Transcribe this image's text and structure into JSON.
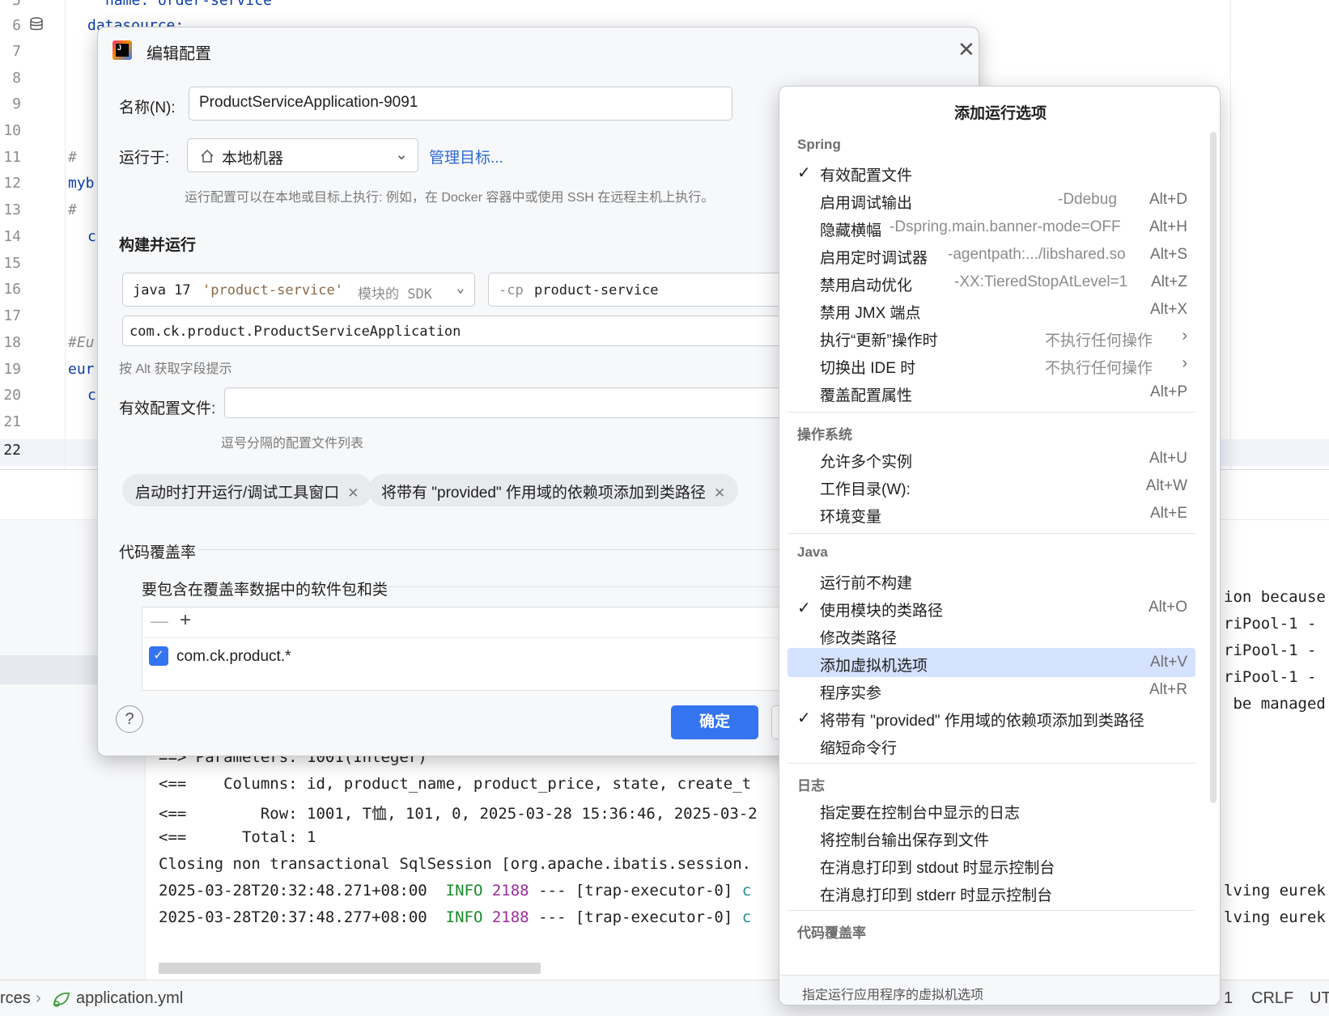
{
  "editor": {
    "line_numbers": [
      "5",
      "6",
      "7",
      "8",
      "9",
      "10",
      "11",
      "12",
      "13",
      "14",
      "15",
      "16",
      "17",
      "18",
      "19",
      "20",
      "21",
      "22"
    ],
    "code": {
      "l5": "name: order-service",
      "l6": "datasource:",
      "l11": "# ",
      "l12": "myb",
      "l13": "# ",
      "l14": "c",
      "l18": "#Eu",
      "l19": "eur",
      "l20": "c"
    }
  },
  "console": {
    "lines": [
      "==> Parameters: 1001(Integer)",
      "<==    Columns: id, product_name, product_price, state, create_t",
      "<==        Row: 1001, T恤, 101, 0, 2025-03-28 15:36:46, 2025-03-2",
      "<==      Total: 1",
      "Closing non transactional SqlSession [org.apache.ibatis.session."
    ],
    "log1": {
      "time": "2025-03-28T20:32:48.271+08:00",
      "level": "INFO",
      "pid": "2188",
      "sep": "---",
      "thread": "[trap-executor-0]",
      "cls": "c"
    },
    "log2": {
      "time": "2025-03-28T20:37:48.277+08:00",
      "level": "INFO",
      "pid": "2188",
      "sep": "---",
      "thread": "[trap-executor-0]",
      "cls": "c"
    },
    "right_lines": [
      "ion because",
      "riPool-1 -",
      "riPool-1 -",
      "riPool-1 -",
      " be managed",
      "",
      "",
      "",
      "",
      "",
      "",
      "lving eurek",
      "lving eurek"
    ]
  },
  "statusbar": {
    "crumb_left": "rces",
    "file": "application.yml",
    "right1": "1",
    "right2": "CRLF",
    "right3": "UT"
  },
  "dialog": {
    "title": "编辑配置",
    "name_label": "名称(N):",
    "name_value": "ProductServiceApplication-9091",
    "run_on_label": "运行于:",
    "run_on_value": "本地机器",
    "manage_targets": "管理目标...",
    "run_on_hint": "运行配置可以在本地或目标上执行: 例如，在 Docker 容器中或使用 SSH 在远程主机上执行。",
    "build_run_title": "构建并运行",
    "sdk_prefix": "java 17",
    "sdk_module": "'product-service'",
    "sdk_suffix": "模块的 SDK",
    "cp_flag": "-cp",
    "cp_value": "product-service",
    "main_class": "com.ck.product.ProductServiceApplication",
    "alt_hint": "按 Alt 获取字段提示",
    "profiles_label": "有效配置文件:",
    "profiles_value": "",
    "profiles_hint": "逗号分隔的配置文件列表",
    "chips": [
      "启动时打开运行/调试工具窗口",
      "将带有 \"provided\" 作用域的依赖项添加到类路径"
    ],
    "coverage_title": "代码覆盖率",
    "coverage_sub": "要包含在覆盖率数据中的软件包和类",
    "coverage_item": "com.ck.product.*",
    "ok": "确定",
    "help": "?"
  },
  "popup": {
    "title": "添加运行选项",
    "groups": {
      "spring": "Spring",
      "os": "操作系统",
      "java": "Java",
      "logs": "日志",
      "coverage": "代码覆盖率"
    },
    "spring_items": [
      {
        "label": "有效配置文件",
        "desc": "",
        "shortcut": "",
        "checked": "✓"
      },
      {
        "label": "启用调试输出",
        "desc": "-Ddebug",
        "shortcut": "Alt+D",
        "checked": ""
      },
      {
        "label": "隐藏横幅",
        "desc": "-Dspring.main.banner-mode=OFF",
        "shortcut": "Alt+H",
        "checked": ""
      },
      {
        "label": "启用定时调试器",
        "desc": "-agentpath:.../libshared.so",
        "shortcut": "Alt+S",
        "checked": ""
      },
      {
        "label": "禁用启动优化",
        "desc": "-XX:TieredStopAtLevel=1",
        "shortcut": "Alt+Z",
        "checked": ""
      },
      {
        "label": "禁用 JMX 端点",
        "desc": "",
        "shortcut": "Alt+X",
        "checked": ""
      },
      {
        "label": "执行“更新”操作时",
        "desc": "不执行任何操作",
        "shortcut": "",
        "checked": ""
      },
      {
        "label": "切换出 IDE 时",
        "desc": "不执行任何操作",
        "shortcut": "",
        "checked": ""
      },
      {
        "label": "覆盖配置属性",
        "desc": "",
        "shortcut": "Alt+P",
        "checked": ""
      }
    ],
    "os_items": [
      {
        "label": "允许多个实例",
        "shortcut": "Alt+U"
      },
      {
        "label": "工作目录(W):",
        "shortcut": "Alt+W"
      },
      {
        "label": "环境变量",
        "shortcut": "Alt+E"
      }
    ],
    "java_items": [
      {
        "label": "运行前不构建",
        "shortcut": "",
        "checked": ""
      },
      {
        "label": "使用模块的类路径",
        "shortcut": "Alt+O",
        "checked": "✓"
      },
      {
        "label": "修改类路径",
        "shortcut": "",
        "checked": ""
      },
      {
        "label": "添加虚拟机选项",
        "shortcut": "Alt+V",
        "checked": ""
      },
      {
        "label": "程序实参",
        "shortcut": "Alt+R",
        "checked": ""
      },
      {
        "label": "将带有 \"provided\" 作用域的依赖项添加到类路径",
        "shortcut": "",
        "checked": "✓"
      },
      {
        "label": "缩短命令行",
        "shortcut": "",
        "checked": ""
      }
    ],
    "log_items": [
      {
        "label": "指定要在控制台中显示的日志"
      },
      {
        "label": "将控制台输出保存到文件"
      },
      {
        "label": "在消息打印到 stdout 时显示控制台"
      },
      {
        "label": "在消息打印到 stderr 时显示控制台"
      }
    ],
    "footer": "指定运行应用程序的虚拟机选项"
  }
}
